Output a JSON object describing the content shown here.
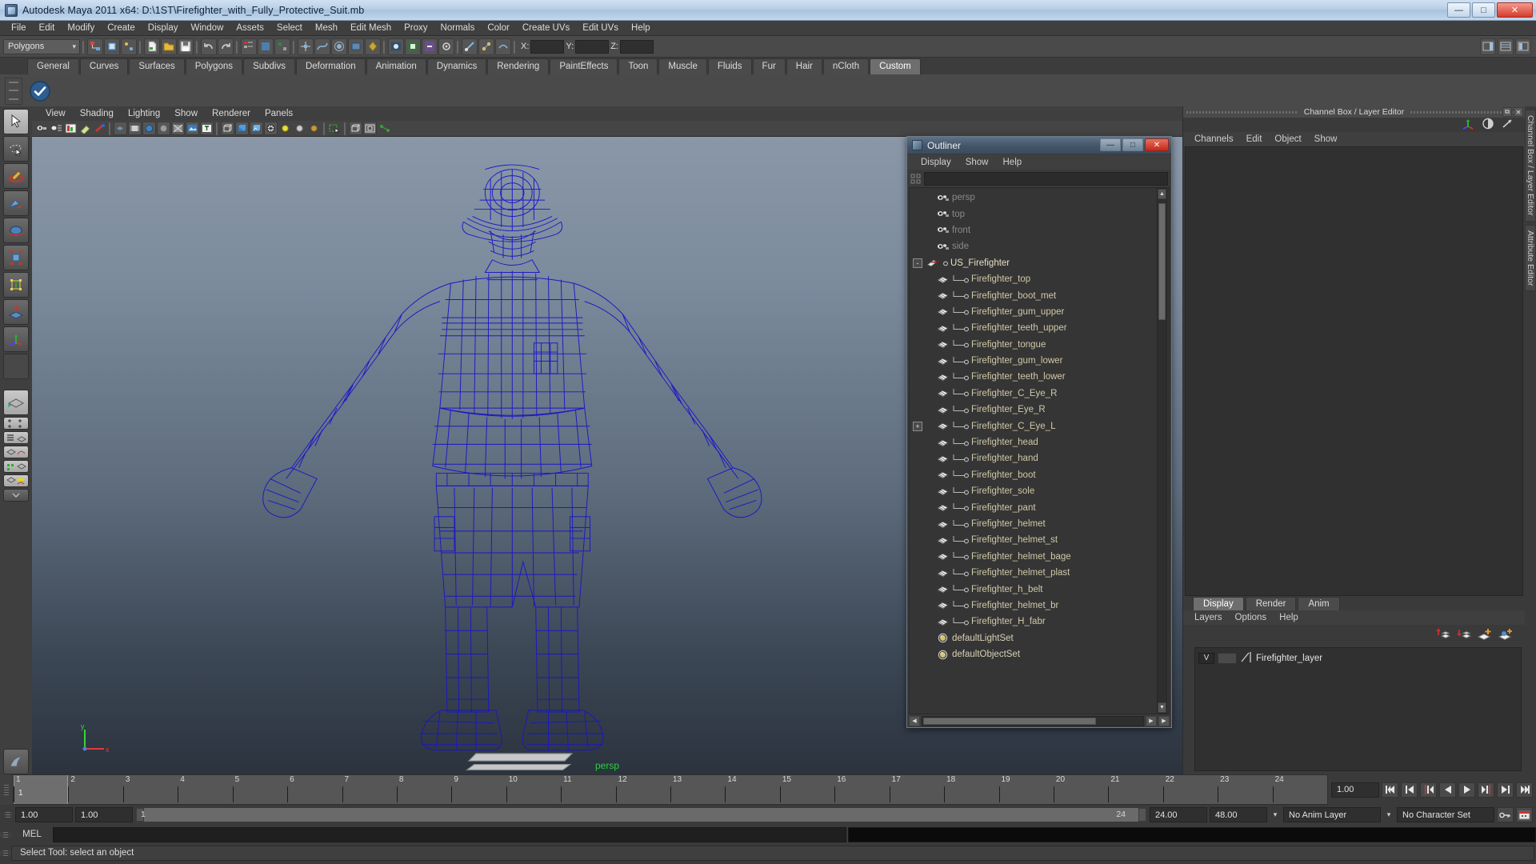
{
  "window": {
    "title": "Autodesk Maya 2011 x64: D:\\1ST\\Firefighter_with_Fully_Protective_Suit.mb",
    "app_icon": "maya-icon",
    "minimize": "—",
    "maximize": "□",
    "close": "✕"
  },
  "menubar": {
    "items": [
      "File",
      "Edit",
      "Modify",
      "Create",
      "Display",
      "Window",
      "Assets",
      "Select",
      "Mesh",
      "Edit Mesh",
      "Proxy",
      "Normals",
      "Color",
      "Create UVs",
      "Edit UVs",
      "Help"
    ]
  },
  "statusline": {
    "selection_mode": "Polygons",
    "x_label": "X:",
    "y_label": "Y:",
    "z_label": "Z:",
    "x_value": "",
    "y_value": "",
    "z_value": ""
  },
  "shelf": {
    "tabs": [
      "General",
      "Curves",
      "Surfaces",
      "Polygons",
      "Subdivs",
      "Deformation",
      "Animation",
      "Dynamics",
      "Rendering",
      "PaintEffects",
      "Toon",
      "Muscle",
      "Fluids",
      "Fur",
      "Hair",
      "nCloth",
      "Custom"
    ],
    "active_tab": "Custom",
    "items": [
      "custom-shelf-button"
    ]
  },
  "toolbox": {
    "tools": [
      {
        "name": "select-tool",
        "selected": true
      },
      {
        "name": "lasso-select-tool",
        "selected": false
      },
      {
        "name": "paint-selection-tool",
        "selected": false
      },
      {
        "name": "move-tool",
        "selected": false
      },
      {
        "name": "rotate-tool",
        "selected": false
      },
      {
        "name": "scale-tool",
        "selected": false
      },
      {
        "name": "universal-manipulator-tool",
        "selected": false
      },
      {
        "name": "soft-modification-tool",
        "selected": false
      },
      {
        "name": "last-tool-used",
        "selected": false
      },
      {
        "name": "blank-tool-slot",
        "selected": false
      }
    ],
    "layouts": [
      {
        "name": "single-perspective-view-layout"
      },
      {
        "name": "four-view-layout"
      },
      {
        "name": "outliner-persp-layout"
      },
      {
        "name": "persp-graph-layout"
      },
      {
        "name": "hypershade-persp-layout"
      },
      {
        "name": "persp-graph-hypergraph-layout"
      },
      {
        "name": "expand-layout-list"
      }
    ]
  },
  "viewport": {
    "menus": [
      "View",
      "Shading",
      "Lighting",
      "Show",
      "Renderer",
      "Panels"
    ],
    "toolbar_icons": [
      "select-camera-icon",
      "camera-attributes-icon",
      "image-plane-icon",
      "two-d-pan-zoom-icon",
      "book-icon",
      "grid-icon",
      "film-gate-icon",
      "resolution-gate-icon",
      "field-chart-icon",
      "safe-action-icon",
      "texture-icon",
      "text-icon",
      "wireframe-icon",
      "smooth-shade-all-icon",
      "smooth-shade-textured-icon",
      "wireframe-on-shaded-icon",
      "lights-default-icon",
      "lights-all-icon",
      "shadows-icon",
      "isolate-select-icon",
      "xray-icon",
      "xray-joints-icon",
      "exposure-icon"
    ],
    "camera_label": "persp",
    "axis_x": "x",
    "axis_y": "y",
    "model_name": "US_Firefighter wireframe",
    "wire_color": "#1a15c8"
  },
  "outliner": {
    "title": "Outliner",
    "icon": "outliner-icon",
    "minimize": "—",
    "maximize": "□",
    "close": "✕",
    "menus": [
      "Display",
      "Show",
      "Help"
    ],
    "search_value": "",
    "rows": [
      {
        "label": "persp",
        "type": "camera",
        "indent": 1,
        "expand": ""
      },
      {
        "label": "top",
        "type": "camera",
        "indent": 1,
        "expand": ""
      },
      {
        "label": "front",
        "type": "camera",
        "indent": 1,
        "expand": ""
      },
      {
        "label": "side",
        "type": "camera",
        "indent": 1,
        "expand": ""
      },
      {
        "label": "US_Firefighter",
        "type": "group",
        "indent": 0,
        "expand": "-"
      },
      {
        "label": "Firefighter_top",
        "type": "mesh",
        "indent": 1,
        "expand": ""
      },
      {
        "label": "Firefighter_boot_met",
        "type": "mesh",
        "indent": 1,
        "expand": ""
      },
      {
        "label": "Firefighter_gum_upper",
        "type": "mesh",
        "indent": 1,
        "expand": ""
      },
      {
        "label": "Firefighter_teeth_upper",
        "type": "mesh",
        "indent": 1,
        "expand": ""
      },
      {
        "label": "Firefighter_tongue",
        "type": "mesh",
        "indent": 1,
        "expand": ""
      },
      {
        "label": "Firefighter_gum_lower",
        "type": "mesh",
        "indent": 1,
        "expand": ""
      },
      {
        "label": "Firefighter_teeth_lower",
        "type": "mesh",
        "indent": 1,
        "expand": ""
      },
      {
        "label": "Firefighter_C_Eye_R",
        "type": "mesh",
        "indent": 1,
        "expand": ""
      },
      {
        "label": "Firefighter_Eye_R",
        "type": "mesh",
        "indent": 1,
        "expand": ""
      },
      {
        "label": "Firefighter_C_Eye_L",
        "type": "mesh",
        "indent": 1,
        "expand": "+"
      },
      {
        "label": "Firefighter_head",
        "type": "mesh",
        "indent": 1,
        "expand": ""
      },
      {
        "label": "Firefighter_hand",
        "type": "mesh",
        "indent": 1,
        "expand": ""
      },
      {
        "label": "Firefighter_boot",
        "type": "mesh",
        "indent": 1,
        "expand": ""
      },
      {
        "label": "Firefighter_sole",
        "type": "mesh",
        "indent": 1,
        "expand": ""
      },
      {
        "label": "Firefighter_pant",
        "type": "mesh",
        "indent": 1,
        "expand": ""
      },
      {
        "label": "Firefighter_helmet",
        "type": "mesh",
        "indent": 1,
        "expand": ""
      },
      {
        "label": "Firefighter_helmet_st",
        "type": "mesh",
        "indent": 1,
        "expand": ""
      },
      {
        "label": "Firefighter_helmet_bage",
        "type": "mesh",
        "indent": 1,
        "expand": ""
      },
      {
        "label": "Firefighter_helmet_plast",
        "type": "mesh",
        "indent": 1,
        "expand": ""
      },
      {
        "label": "Firefighter_h_belt",
        "type": "mesh",
        "indent": 1,
        "expand": ""
      },
      {
        "label": "Firefighter_helmet_br",
        "type": "mesh",
        "indent": 1,
        "expand": ""
      },
      {
        "label": "Firefighter_H_fabr",
        "type": "mesh",
        "indent": 1,
        "expand": ""
      },
      {
        "label": "defaultLightSet",
        "type": "set",
        "indent": 0,
        "expand": ""
      },
      {
        "label": "defaultObjectSet",
        "type": "set",
        "indent": 0,
        "expand": ""
      }
    ]
  },
  "channelbox": {
    "panel_title": "Channel Box / Layer Editor",
    "undock": "⧉",
    "close": "✕",
    "menus": [
      "Channels",
      "Edit",
      "Object",
      "Show"
    ],
    "tool_icons": [
      "channel-box-icon",
      "attribute-editor-icon",
      "tool-settings-icon"
    ],
    "side_tabs": [
      "Channel Box / Layer Editor",
      "Attribute Editor"
    ]
  },
  "layereditor": {
    "tabs": [
      "Display",
      "Render",
      "Anim"
    ],
    "active_tab": "Display",
    "menus": [
      "Layers",
      "Options",
      "Help"
    ],
    "buttons": [
      "move-layer-up-icon",
      "move-layer-down-icon",
      "new-layer-icon",
      "new-layer-from-selected-icon"
    ],
    "layers": [
      {
        "visibility": "V",
        "type": "",
        "name": "Firefighter_layer"
      }
    ]
  },
  "timeslider": {
    "ticks": [
      "1",
      "2",
      "3",
      "4",
      "5",
      "6",
      "7",
      "8",
      "9",
      "10",
      "11",
      "12",
      "13",
      "14",
      "15",
      "16",
      "17",
      "18",
      "19",
      "20",
      "21",
      "22",
      "23",
      "24"
    ],
    "current_frame": "1",
    "current_frame_field": "1.00",
    "playback_buttons": [
      "go-to-start-icon",
      "step-back-keyframe-icon",
      "step-back-frame-icon",
      "play-backwards-icon",
      "play-forwards-icon",
      "step-forward-frame-icon",
      "step-forward-keyframe-icon",
      "go-to-end-icon"
    ]
  },
  "rangeslider": {
    "anim_start": "1.00",
    "range_start": "1.00",
    "range_bar_start": "1",
    "range_bar_end": "24",
    "range_end": "24.00",
    "anim_end": "48.00",
    "anim_layer": "No Anim Layer",
    "character_set": "No Character Set",
    "key_icon": "key-icon",
    "auto_key_icon": "auto-keyframe-icon",
    "anim_prefs_icon": "animation-preferences-icon"
  },
  "commandline": {
    "label": "MEL",
    "input_value": "",
    "output_value": ""
  },
  "helpline": {
    "text": "Select Tool: select an object"
  }
}
